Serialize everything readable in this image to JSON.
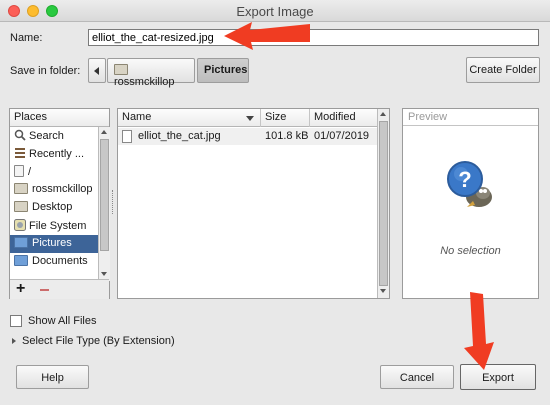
{
  "window": {
    "title": "Export Image"
  },
  "name_row": {
    "label": "Name:",
    "value": "elliot_the_cat-resized.jpg"
  },
  "folder_row": {
    "label": "Save in folder:",
    "crumbs": [
      "rossmckillop",
      "Pictures"
    ],
    "create_folder": "Create Folder"
  },
  "places": {
    "header": "Places",
    "items": [
      {
        "label": "Search",
        "icon": "search-icon"
      },
      {
        "label": "Recently ...",
        "icon": "recent-icon"
      },
      {
        "label": "/",
        "icon": "document-icon"
      },
      {
        "label": "rossmckillop",
        "icon": "folder-icon"
      },
      {
        "label": "Desktop",
        "icon": "folder-icon"
      },
      {
        "label": "File System",
        "icon": "drive-icon"
      },
      {
        "label": "Pictures",
        "icon": "folder-icon"
      },
      {
        "label": "Documents",
        "icon": "folder-icon"
      }
    ],
    "add_symbol": "+"
  },
  "files": {
    "columns": [
      "Name",
      "Size",
      "Modified"
    ],
    "rows": [
      {
        "name": "elliot_the_cat.jpg",
        "size": "101.8 kB",
        "modified": "01/07/2019"
      }
    ]
  },
  "preview": {
    "header": "Preview",
    "empty": "No selection"
  },
  "options": {
    "show_all_files": "Show All Files",
    "select_file_type": "Select File Type (By Extension)"
  },
  "buttons": {
    "help": "Help",
    "cancel": "Cancel",
    "export": "Export"
  },
  "colors": {
    "selection": "#3d6498",
    "annotation_arrow": "#f03c22"
  }
}
